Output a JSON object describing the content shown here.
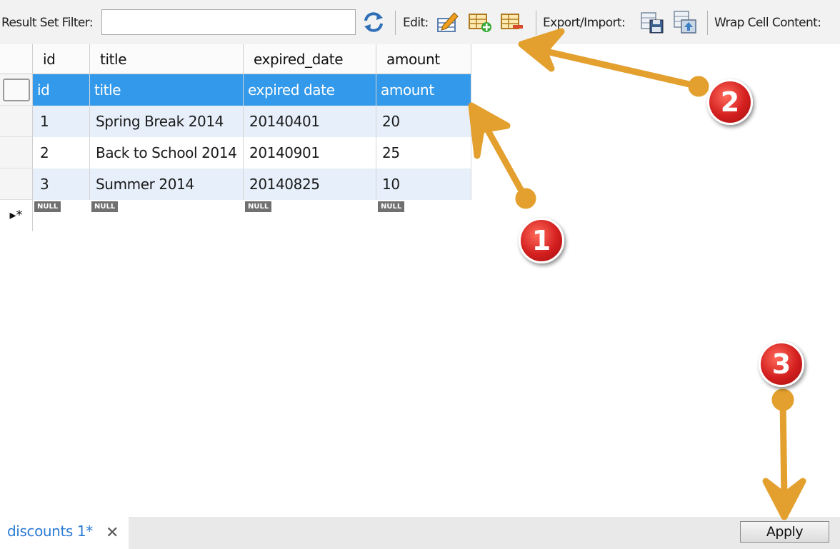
{
  "toolbar": {
    "filter_label": "Result Set Filter:",
    "filter_value": "",
    "edit_label": "Edit:",
    "export_label": "Export/Import:",
    "wrap_label": "Wrap Cell Content:"
  },
  "columns": [
    "id",
    "title",
    "expired_date",
    "amount"
  ],
  "rows": [
    [
      "id",
      "title",
      "expired date",
      "amount"
    ],
    [
      "1",
      "Spring Break 2014",
      "20140401",
      "20"
    ],
    [
      "2",
      "Back to School 2014",
      "20140901",
      "25"
    ],
    [
      "3",
      "Summer 2014",
      "20140825",
      "10"
    ]
  ],
  "null_label": "NULL",
  "new_row_marker": "▸*",
  "tab": {
    "label": "discounts 1*",
    "close": "✕"
  },
  "apply_label": "Apply",
  "annotations": [
    "1",
    "2",
    "3"
  ],
  "colors": {
    "selection": "#3399ea",
    "alt_row": "#e6effa",
    "arrow": "#e3a02e",
    "badge": "#d31f1f",
    "tab_text": "#2a7bd4"
  }
}
